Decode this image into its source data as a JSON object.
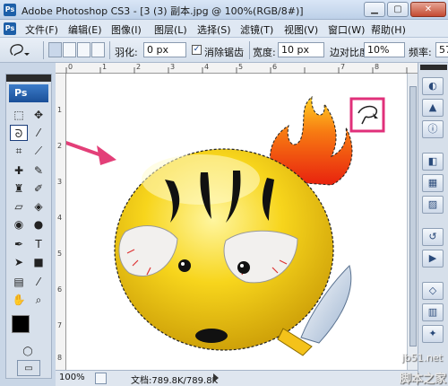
{
  "window": {
    "title": "Adobe Photoshop CS3 - [3 (3) 副本.jpg @ 100%(RGB/8#)]",
    "minimize": "▁",
    "maximize": "▢",
    "close": "✕"
  },
  "menu": {
    "app_icon": "Ps",
    "items": [
      "文件(F)",
      "编辑(E)",
      "图像(I)",
      "图层(L)",
      "选择(S)",
      "滤镜(T)",
      "视图(V)",
      "窗口(W)",
      "帮助(H)"
    ]
  },
  "options": {
    "feather_label": "羽化:",
    "feather_value": "0 px",
    "antialias_label": "消除锯齿",
    "antialias_checked": true,
    "width_label": "宽度:",
    "width_value": "10 px",
    "contrast_label": "边对比度:",
    "contrast_value": "10%",
    "frequency_label": "频率:",
    "frequency_value": "57"
  },
  "toolbox": {
    "logo": "Ps"
  },
  "status": {
    "zoom": "100%",
    "doc": "文档:789.8K/789.8K"
  },
  "ruler": {
    "top_ticks": [
      "0",
      "1",
      "2",
      "3",
      "4",
      "5",
      "6",
      "7",
      "8"
    ],
    "left_ticks": [
      "1",
      "2",
      "3",
      "4",
      "5",
      "6",
      "7",
      "8"
    ]
  },
  "watermark": {
    "site": "jb51.net",
    "name": "脚本之家"
  },
  "colors": {
    "accent_box": "#e0307a",
    "arrow": "#e33f78",
    "face": "#f5d21a"
  }
}
